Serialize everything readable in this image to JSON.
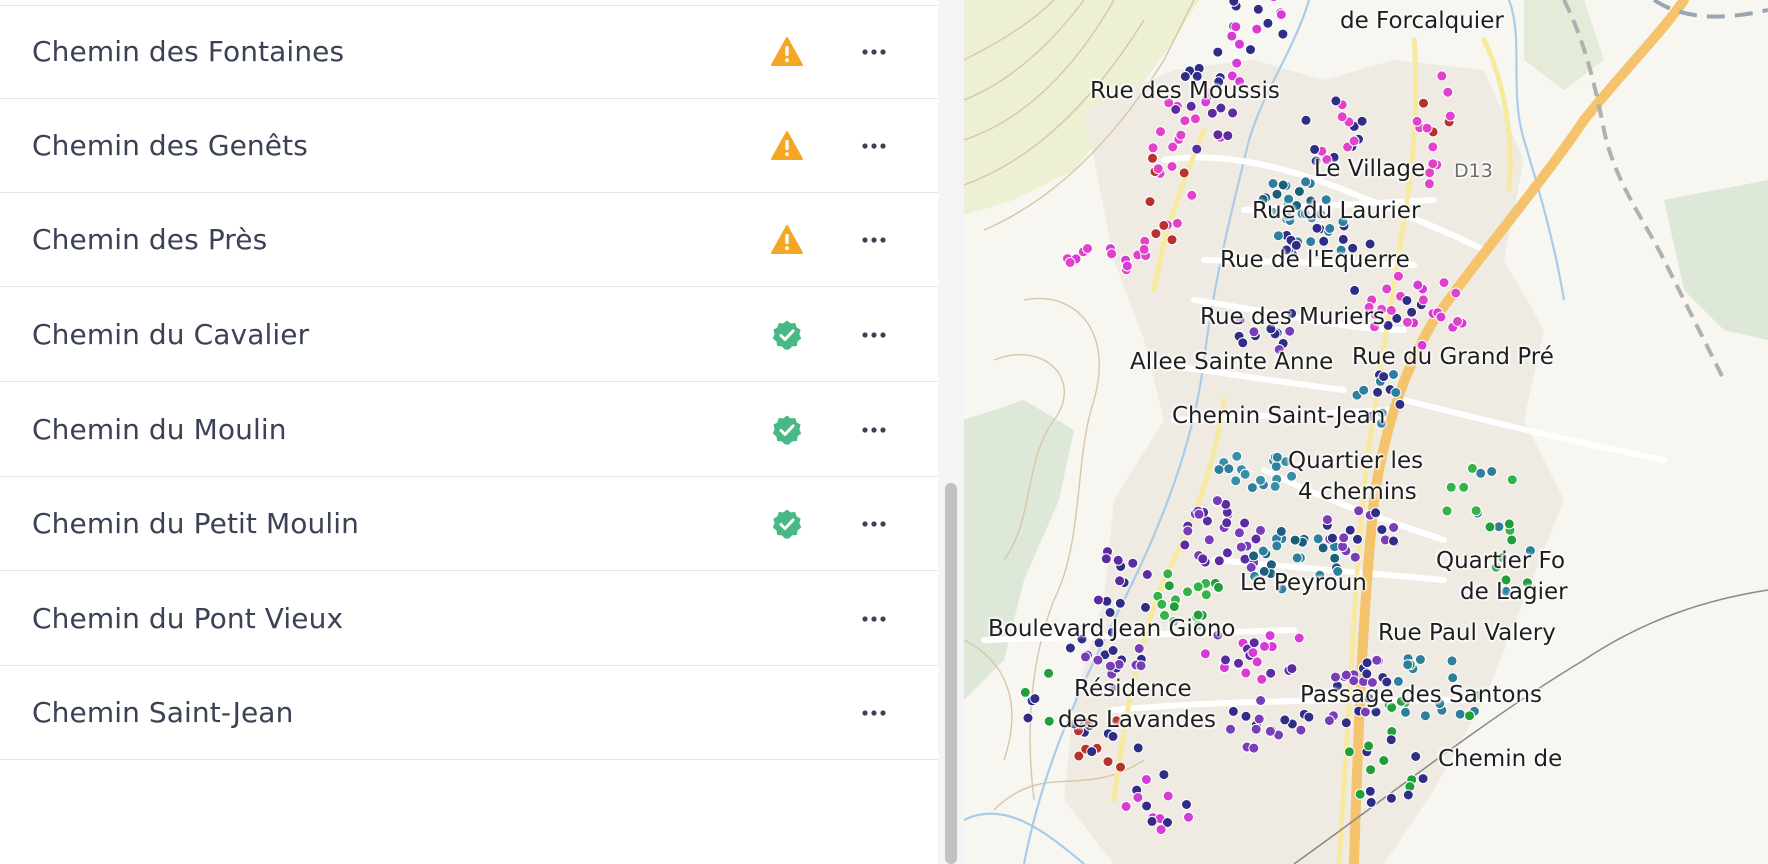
{
  "streets": [
    {
      "name": "Chemin des Fontaines",
      "status": "warning"
    },
    {
      "name": "Chemin des Genêts",
      "status": "warning"
    },
    {
      "name": "Chemin des Près",
      "status": "warning"
    },
    {
      "name": "Chemin du Cavalier",
      "status": "validated"
    },
    {
      "name": "Chemin du Moulin",
      "status": "validated"
    },
    {
      "name": "Chemin du Petit Moulin",
      "status": "validated"
    },
    {
      "name": "Chemin du Pont Vieux",
      "status": "none"
    },
    {
      "name": "Chemin Saint-Jean",
      "status": "none"
    }
  ],
  "colors": {
    "warning": "#f5a623",
    "validated": "#48b886",
    "more": "#3b4256",
    "text": "#3b4256"
  },
  "icons": {
    "warning": "warning-triangle-icon",
    "validated": "check-badge-icon",
    "more": "ellipsis-icon"
  },
  "map": {
    "labels": [
      "de Forcalquier",
      "Rue des Moussis",
      "Le Village",
      "D13",
      "Rue du Laurier",
      "Rue de l'Equerre",
      "Rue des Muriers",
      "Allee Sainte Anne",
      "Rue du Grand Pré",
      "Chemin Saint-Jean",
      "Quartier les",
      "4 chemins",
      "Quartier Fo",
      "de Lagier",
      "Le Peyroun",
      "Boulevard Jean Giono",
      "Rue Paul Valery",
      "Résidence",
      "des Lavandes",
      "Passage des Santons",
      "Chemin de"
    ]
  }
}
